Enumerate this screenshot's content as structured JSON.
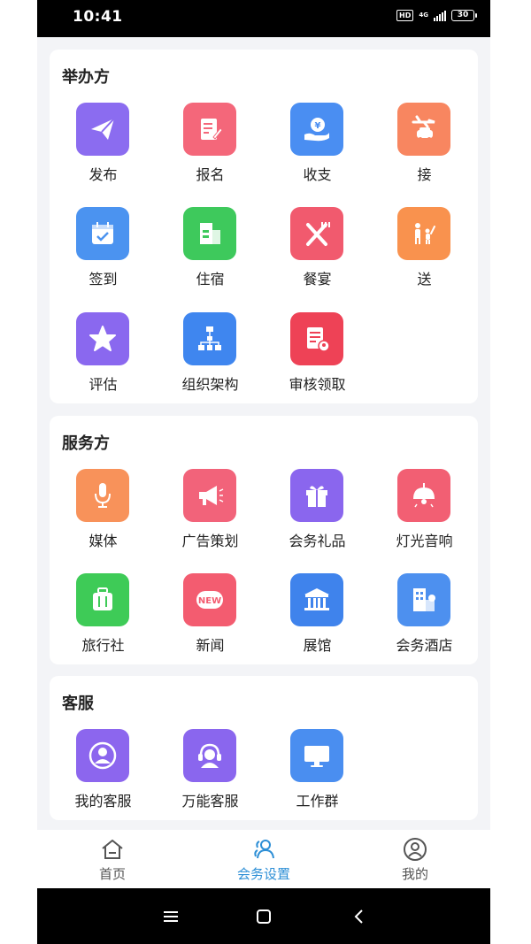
{
  "status_bar": {
    "time": "10:41",
    "hd": "HD",
    "network": "4G",
    "battery": "30"
  },
  "sections": [
    {
      "title": "举办方",
      "items": [
        {
          "label": "发布",
          "icon": "paper-plane-icon",
          "color": "#8b6cf0"
        },
        {
          "label": "报名",
          "icon": "form-edit-icon",
          "color": "#f4677a"
        },
        {
          "label": "收支",
          "icon": "yuan-hand-icon",
          "color": "#4a8ef2"
        },
        {
          "label": "接",
          "icon": "plane-car-icon",
          "color": "#f88660"
        },
        {
          "label": "签到",
          "icon": "calendar-check-icon",
          "color": "#4b93f0"
        },
        {
          "label": "住宿",
          "icon": "building-icon",
          "color": "#3ec95c"
        },
        {
          "label": "餐宴",
          "icon": "fork-knife-icon",
          "color": "#f15a6e"
        },
        {
          "label": "送",
          "icon": "people-wave-icon",
          "color": "#f9924e"
        },
        {
          "label": "评估",
          "icon": "star-icon",
          "color": "#8a68ef"
        },
        {
          "label": "组织架构",
          "icon": "org-chart-icon",
          "color": "#3f86ef"
        },
        {
          "label": "审核领取",
          "icon": "document-seal-icon",
          "color": "#ee4256"
        }
      ]
    },
    {
      "title": "服务方",
      "items": [
        {
          "label": "媒体",
          "icon": "microphone-icon",
          "color": "#f8925a"
        },
        {
          "label": "广告策划",
          "icon": "megaphone-icon",
          "color": "#f2637a"
        },
        {
          "label": "会务礼品",
          "icon": "gift-icon",
          "color": "#8a66ee"
        },
        {
          "label": "灯光音响",
          "icon": "ceiling-lamp-icon",
          "color": "#f25f73"
        },
        {
          "label": "旅行社",
          "icon": "suitcase-icon",
          "color": "#3ecb57"
        },
        {
          "label": "新闻",
          "icon": "new-badge-icon",
          "color": "#f35c70"
        },
        {
          "label": "展馆",
          "icon": "museum-icon",
          "color": "#3f83ec"
        },
        {
          "label": "会务酒店",
          "icon": "hotel-icon",
          "color": "#4d90ef"
        }
      ]
    },
    {
      "title": "客服",
      "items": [
        {
          "label": "我的客服",
          "icon": "user-circle-icon",
          "color": "#8c66ee"
        },
        {
          "label": "万能客服",
          "icon": "headset-agent-icon",
          "color": "#8a66ee"
        },
        {
          "label": "工作群",
          "icon": "monitor-icon",
          "color": "#4a8ef0"
        }
      ]
    }
  ],
  "tab_bar": [
    {
      "label": "首页",
      "icon": "home-icon",
      "active": false
    },
    {
      "label": "会务设置",
      "icon": "people-icon",
      "active": true
    },
    {
      "label": "我的",
      "icon": "profile-icon",
      "active": false
    }
  ],
  "colors": {
    "accent": "#2e8fd6",
    "background": "#f3f4f7"
  }
}
